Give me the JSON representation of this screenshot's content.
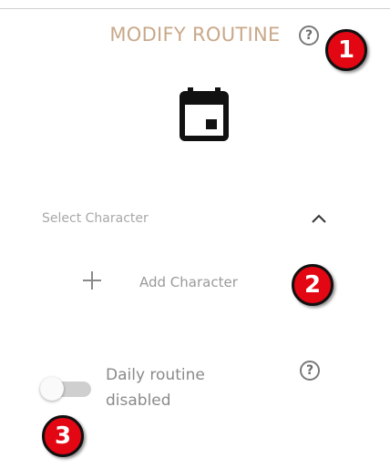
{
  "header": {
    "title": "MODIFY ROUTINE",
    "help_icon": "question-circle-icon"
  },
  "calendar_icon": "calendar-icon",
  "character_section": {
    "label": "Select Character",
    "collapse_icon": "chevron-up-icon",
    "add_label": "Add Character",
    "add_icon": "plus-icon"
  },
  "routine": {
    "toggle_on": false,
    "label": "Daily routine disabled",
    "help_icon": "question-circle-icon"
  },
  "markers": [
    "1",
    "2",
    "3"
  ],
  "colors": {
    "title": "#c9a889",
    "marker_red": "#e30613",
    "icon_dark": "#111111"
  }
}
